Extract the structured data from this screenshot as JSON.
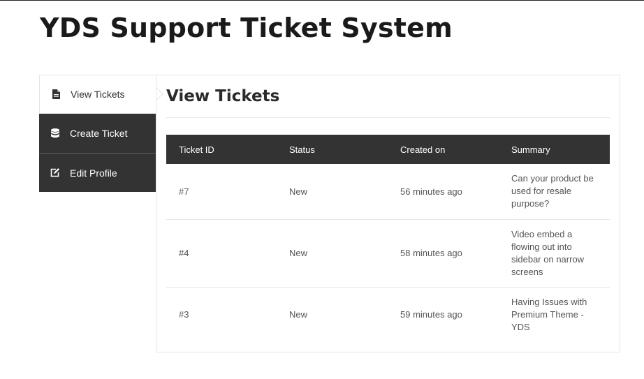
{
  "site": {
    "title": "YDS Support Ticket System"
  },
  "sidebar": {
    "items": [
      {
        "label": "View Tickets",
        "icon": "document-icon",
        "active": true
      },
      {
        "label": "Create Ticket",
        "icon": "database-icon",
        "active": false
      },
      {
        "label": "Edit Profile",
        "icon": "edit-icon",
        "active": false
      }
    ]
  },
  "main": {
    "title": "View Tickets",
    "table": {
      "headers": [
        "Ticket ID",
        "Status",
        "Created on",
        "Summary"
      ],
      "rows": [
        {
          "id": "#7",
          "status": "New",
          "created": "56 minutes ago",
          "summary": "Can your product be used for resale purpose?"
        },
        {
          "id": "#4",
          "status": "New",
          "created": "58 minutes ago",
          "summary": "Video embed a flowing out into sidebar on narrow screens"
        },
        {
          "id": "#3",
          "status": "New",
          "created": "59 minutes ago",
          "summary": "Having Issues with Premium Theme - YDS"
        }
      ]
    }
  },
  "colors": {
    "dark": "#333333",
    "border": "#e5e5e5"
  }
}
